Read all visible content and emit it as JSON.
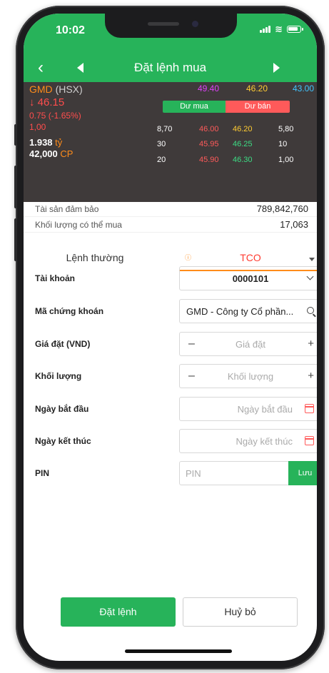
{
  "status": {
    "time": "10:02"
  },
  "nav": {
    "title": "Đặt lệnh mua"
  },
  "quote": {
    "symbol": "GMD",
    "exchange": "(HSX)",
    "price": "↓ 46.15",
    "change": "0.75 (-1.65%)",
    "change2": "1,00",
    "value_num": "1.938",
    "value_unit": "tỷ",
    "volume_num": "42,000",
    "volume_unit": "CP",
    "ceiling": "49.40",
    "reference": "46.20",
    "floor": "43.00",
    "buy_label": "Dư mua",
    "sell_label": "Dư bán",
    "colors": {
      "ceiling": "#e040fb",
      "reference": "#ffcc33",
      "floor": "#40c4ff",
      "down": "#ff4d4d",
      "up": "#3ddc84"
    },
    "depth": [
      {
        "bid_vol": "8,70",
        "bid": "46.00",
        "ask": "46.20",
        "ask_vol": "5,80"
      },
      {
        "bid_vol": "30",
        "bid": "45.95",
        "ask": "46.25",
        "ask_vol": "10"
      },
      {
        "bid_vol": "20",
        "bid": "45.90",
        "ask": "46.30",
        "ask_vol": "1,00"
      }
    ]
  },
  "assets": {
    "label": "Tài sản đảm bảo",
    "value": "789,842,760"
  },
  "buyable": {
    "label": "Khối lượng có thể mua",
    "value": "17,063"
  },
  "tabs": {
    "normal": "Lệnh thường",
    "tco": "TCO"
  },
  "form": {
    "account_label": "Tài khoản",
    "account_value": "0000101",
    "stock_label": "Mã chứng khoán",
    "stock_value": "GMD - Công ty Cổ phần...",
    "price_label": "Giá đặt (VND)",
    "price_placeholder": "Giá đặt",
    "qty_label": "Khối lượng",
    "qty_placeholder": "Khối lượng",
    "start_label": "Ngày bắt đầu",
    "start_placeholder": "Ngày bắt đầu",
    "end_label": "Ngày kết thúc",
    "end_placeholder": "Ngày kết thúc",
    "pin_label": "PIN",
    "pin_placeholder": "PIN",
    "save_label": "Lưu"
  },
  "actions": {
    "order": "Đặt lệnh",
    "cancel": "Huỷ bỏ"
  },
  "colors": {
    "primary": "#27b35a",
    "accent": "#ff8c1a",
    "header_dark": "#3f3a3a"
  }
}
